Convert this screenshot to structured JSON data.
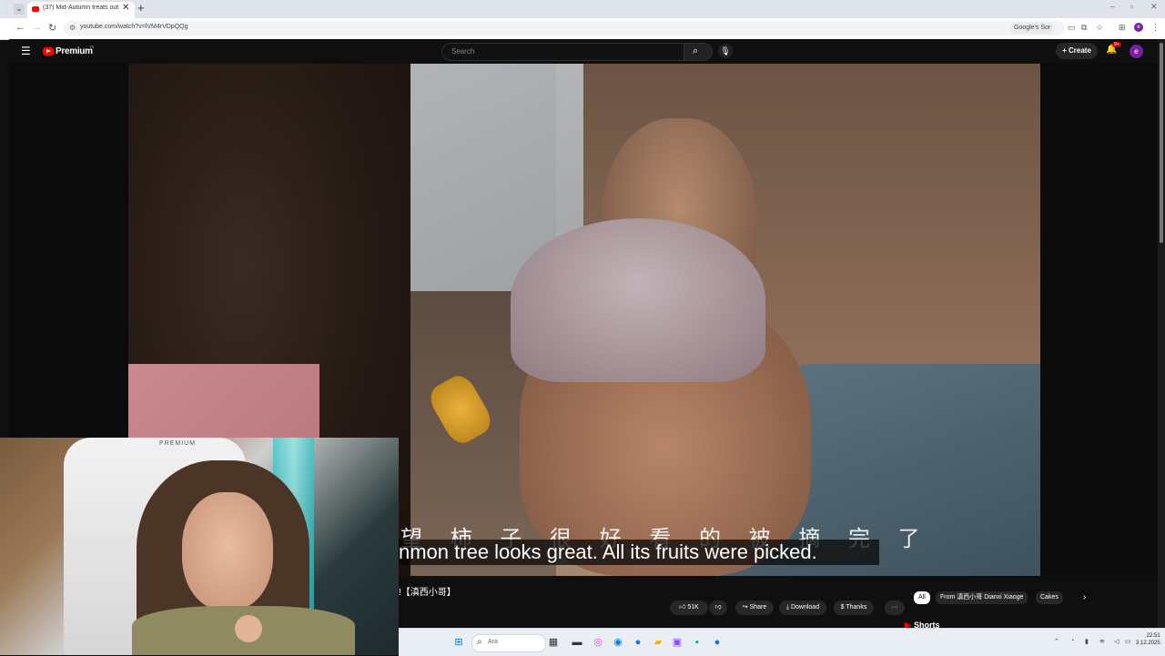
{
  "browser": {
    "tab_title": "(37) Mid-Autumn treats out...",
    "tab_close": "✕",
    "new_tab": "+",
    "url": "youtube.com/watch?v=lVM4rVDpQQg",
    "translate_label": "Google's Sor",
    "window_controls": [
      "–",
      "▫",
      "✕"
    ]
  },
  "youtube": {
    "logo_text": "Premium",
    "logo_country": "TR",
    "search_placeholder": "Search",
    "create_label": "Create",
    "notification_count": "9+",
    "avatar_letter": "e"
  },
  "video": {
    "caption_en": "nmon tree looks great. All its fruits were picked.",
    "caption_cn": "望 柿 子 很 好 看 的   被 摘 完 了",
    "title": "!【滇西小哥】"
  },
  "actions": {
    "like_count": "51K",
    "share": "Share",
    "download": "Download",
    "thanks": "Thanks",
    "more": "···"
  },
  "chips": [
    "All",
    "From 滇西小哥 Dianxi Xiaoge",
    "Cakes"
  ],
  "shorts_label": "Shorts",
  "webcam": {
    "chair_text": "PREMIUM"
  },
  "taskbar": {
    "search_text": "Ara",
    "time": "22:51",
    "date": "3.12.2025"
  }
}
